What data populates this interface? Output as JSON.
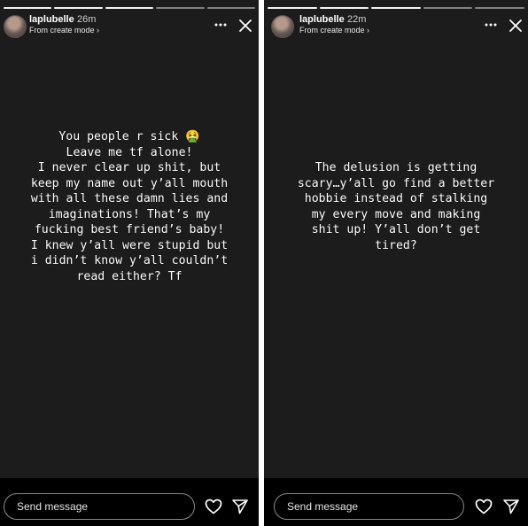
{
  "stories": [
    {
      "username": "laplubelle",
      "time_ago": "26m",
      "mode_link": "From create mode ›",
      "text": "You people r sick 🤮\nLeave me tf alone!\nI never clear up shit, but\nkeep my name out y’all mouth\nwith all these damn lies and\nimaginations! That’s my\nfucking best friend’s baby!\nI knew y’all were stupid but\ni didn’t know y’all couldn’t\nread either? Tf",
      "progress_segments": 5,
      "progress_completed": 3,
      "message_placeholder": "Send message",
      "icons": {
        "more": "more-dots-icon",
        "close": "close-icon",
        "like": "heart-icon",
        "share": "paper-plane-icon"
      }
    },
    {
      "username": "laplubelle",
      "time_ago": "22m",
      "mode_link": "From create mode ›",
      "text": "The delusion is getting\nscary…y’all go find a better\nhobbie instead of stalking\nmy every move and making\nshit up! Y’all don’t get\ntired?",
      "progress_segments": 5,
      "progress_completed": 3,
      "message_placeholder": "Send message",
      "icons": {
        "more": "more-dots-icon",
        "close": "close-icon",
        "like": "heart-icon",
        "share": "paper-plane-icon"
      }
    }
  ],
  "colors": {
    "story_background": "#1c1c1c",
    "footer_background": "#000000",
    "text": "#ffffff"
  }
}
